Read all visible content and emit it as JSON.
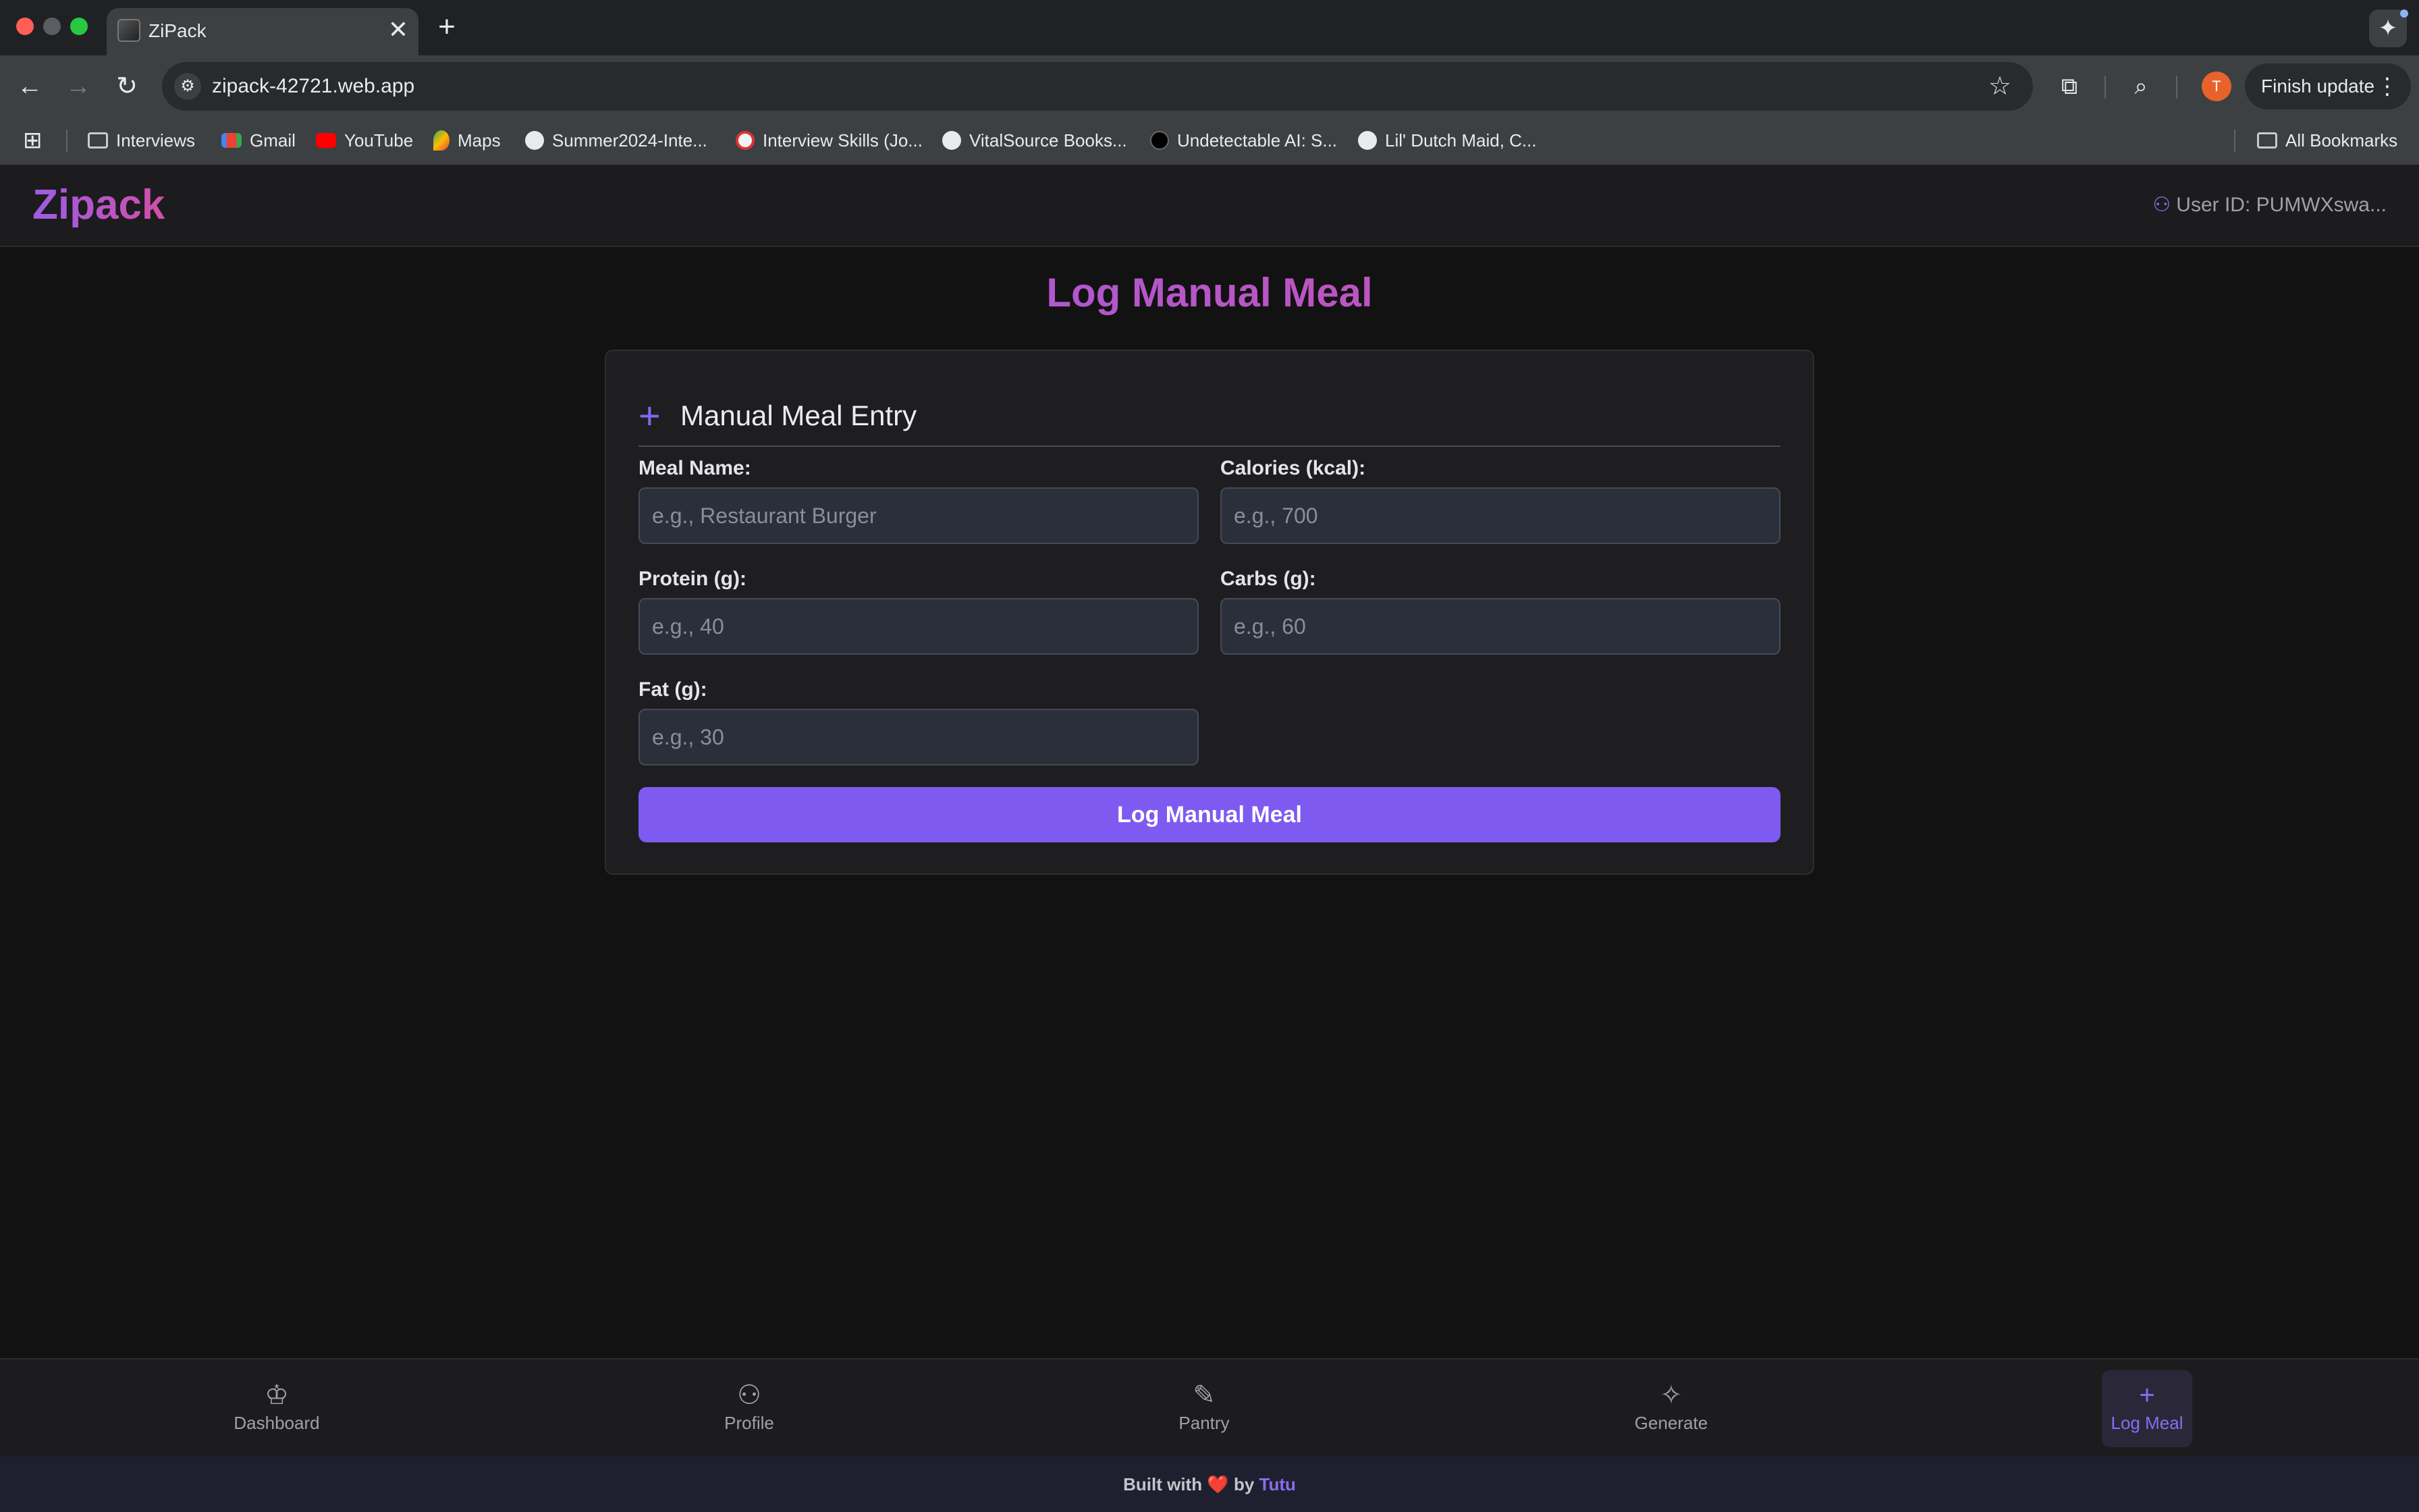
{
  "browser": {
    "tab_title": "ZiPack",
    "tab_close": "✕",
    "new_tab": "+",
    "url": "zipack-42721.web.app",
    "finish_update": "Finish update",
    "profile_initial": "T",
    "bookmarks": [
      {
        "label": "Interviews",
        "icon": "folder-icon"
      },
      {
        "label": "Gmail",
        "icon": "gmail-icon"
      },
      {
        "label": "YouTube",
        "icon": "youtube-icon"
      },
      {
        "label": "Maps",
        "icon": "maps-icon"
      },
      {
        "label": "Summer2024-Inte...",
        "icon": "github-icon"
      },
      {
        "label": "Interview Skills (Jo...",
        "icon": "site-icon"
      },
      {
        "label": "VitalSource Books...",
        "icon": "globe-icon"
      },
      {
        "label": "Undetectable AI: S...",
        "icon": "site-icon"
      },
      {
        "label": "Lil' Dutch Maid, C...",
        "icon": "globe-icon"
      }
    ],
    "all_bookmarks": "All Bookmarks"
  },
  "app": {
    "logo": "Zipack",
    "user_id": "User ID: PUMWXswa..."
  },
  "page": {
    "title": "Log Manual Meal",
    "card_title": "Manual Meal Entry",
    "fields": {
      "meal_name": {
        "label": "Meal Name:",
        "placeholder": "e.g., Restaurant Burger"
      },
      "calories": {
        "label": "Calories (kcal):",
        "placeholder": "e.g., 700"
      },
      "protein": {
        "label": "Protein (g):",
        "placeholder": "e.g., 40"
      },
      "carbs": {
        "label": "Carbs (g):",
        "placeholder": "e.g., 60"
      },
      "fat": {
        "label": "Fat (g):",
        "placeholder": "e.g., 30"
      }
    },
    "submit": "Log Manual Meal"
  },
  "bottom_nav": [
    {
      "label": "Dashboard",
      "icon": "chef-hat-icon",
      "active": false
    },
    {
      "label": "Profile",
      "icon": "user-icon",
      "active": false
    },
    {
      "label": "Pantry",
      "icon": "carrot-icon",
      "active": false
    },
    {
      "label": "Generate",
      "icon": "sparkles-icon",
      "active": false
    },
    {
      "label": "Log Meal",
      "icon": "plus-icon",
      "active": true
    }
  ],
  "footer": {
    "prefix": "Built with",
    "heart": "❤️",
    "by": "by",
    "brand": "Tutu"
  },
  "colors": {
    "accent": "#7f5af0",
    "logo_gradient_start": "#9b5de5",
    "logo_gradient_end": "#d24fa8",
    "background": "#121212"
  }
}
